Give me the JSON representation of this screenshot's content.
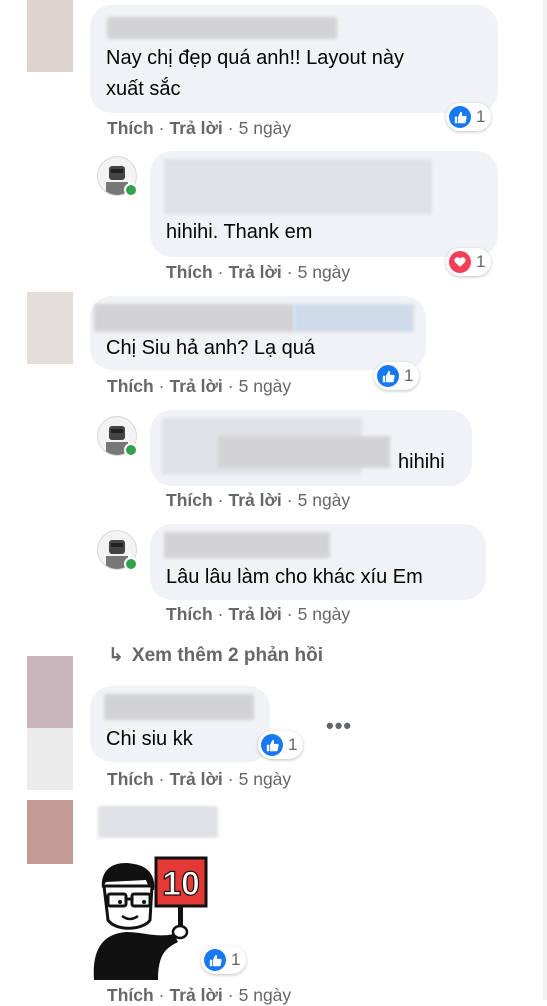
{
  "actions": {
    "like": "Thích",
    "reply": "Trả lời",
    "separator": "·",
    "time": "5 ngày"
  },
  "comments": [
    {
      "text_line1": "Nay chị đẹp quá anh!! Layout này",
      "text_line2": "xuất sắc",
      "reaction": "like",
      "count": "1"
    },
    {
      "text": "hihihi. Thank em",
      "reaction": "love",
      "count": "1"
    },
    {
      "text": "Chị Siu hả anh? Lạ quá",
      "reaction": "like",
      "count": "1"
    },
    {
      "text": "hihihi"
    },
    {
      "text": "Lâu lâu làm cho khác xíu Em"
    },
    {
      "text": "Chi siu kk",
      "reaction": "like",
      "count": "1"
    },
    {
      "sticker_text": "10",
      "reaction": "like",
      "count": "1"
    }
  ],
  "more_replies": "Xem thêm 2 phản hồi",
  "more_options": "•••",
  "colors": {
    "bubble": "#f0f2f5",
    "action_text": "#65676b",
    "like_blue": "#1877f2",
    "love_red": "#f33e58",
    "online_green": "#31a24c"
  }
}
